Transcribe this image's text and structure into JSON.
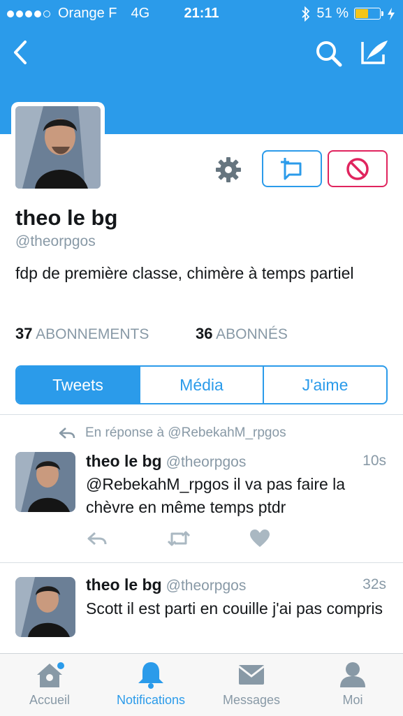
{
  "status_bar": {
    "carrier": "Orange F",
    "network": "4G",
    "time": "21:11",
    "battery": "51 %",
    "battery_level": 0.51
  },
  "profile": {
    "name": "theo le bg",
    "handle": "@theorpgos",
    "bio": "fdp de première classe, chimère à temps partiel",
    "following_count": "37",
    "following_label": "ABONNEMENTS",
    "followers_count": "36",
    "followers_label": "ABONNÉS"
  },
  "tabs": [
    "Tweets",
    "Média",
    "J'aime"
  ],
  "tweets": [
    {
      "reply_context": "En réponse à @RebekahM_rpgos",
      "name": "theo le bg",
      "handle": "@theorpgos",
      "time": "10s",
      "text": "@RebekahM_rpgos il va pas faire la chèvre en même temps ptdr"
    },
    {
      "name": "theo le bg",
      "handle": "@theorpgos",
      "time": "32s",
      "text": "Scott il est parti en couille j'ai pas compris"
    }
  ],
  "bottom_nav": [
    {
      "label": "Accueil",
      "icon": "home-icon"
    },
    {
      "label": "Notifications",
      "icon": "bell-icon",
      "active": true
    },
    {
      "label": "Messages",
      "icon": "envelope-icon"
    },
    {
      "label": "Moi",
      "icon": "person-icon"
    }
  ],
  "colors": {
    "accent": "#2b9bea",
    "block": "#e0245e",
    "muted": "#8899a6"
  }
}
